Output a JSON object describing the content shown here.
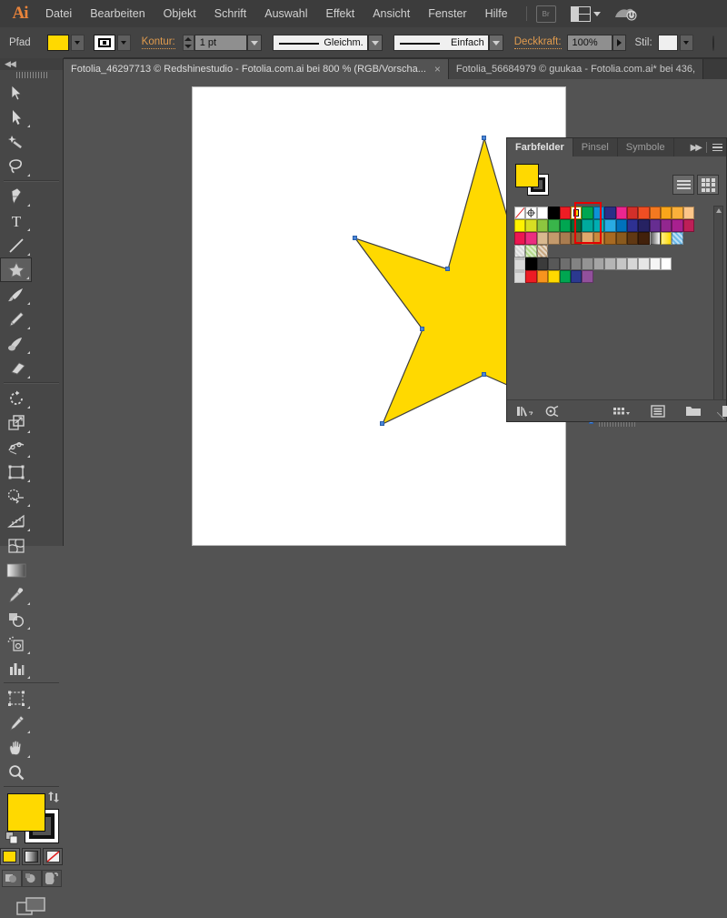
{
  "app": {
    "logo": "Ai",
    "menu": [
      "Datei",
      "Bearbeiten",
      "Objekt",
      "Schrift",
      "Auswahl",
      "Effekt",
      "Ansicht",
      "Fenster",
      "Hilfe"
    ],
    "bridge_label": "Br",
    "arrange_label": "arrange-documents",
    "cloud_label": "creative-cloud-sync"
  },
  "control_bar": {
    "object_type": "Pfad",
    "fill_color": "#ffd900",
    "stroke_color": "#000000",
    "stroke_label": "Kontur:",
    "stroke_weight": "1 pt",
    "variable_width_profile": "Gleichm.",
    "brush_definition": "Einfach",
    "opacity_label": "Deckkraft:",
    "opacity_value": "100%",
    "style_label": "Stil:",
    "style_swatch": "#efefef"
  },
  "tabs": [
    {
      "title": "Fotolia_46297713 © Redshinestudio - Fotolia.com.ai bei 800 % (RGB/Vorscha...",
      "close": "×",
      "active": true
    },
    {
      "title": "Fotolia_56684979 © guukaa - Fotolia.com.ai* bei 436,",
      "close": "",
      "active": false
    }
  ],
  "tools": {
    "header_collapse": "◀◀",
    "items": [
      {
        "name": "selection-tool",
        "selected": false
      },
      {
        "name": "direct-selection-tool",
        "selected": false
      },
      {
        "name": "magic-wand-tool",
        "selected": false
      },
      {
        "name": "lasso-tool",
        "selected": false
      },
      {
        "name": "pen-tool",
        "selected": false
      },
      {
        "name": "type-tool",
        "selected": false
      },
      {
        "name": "line-segment-tool",
        "selected": false
      },
      {
        "name": "star-tool",
        "selected": true
      },
      {
        "name": "paintbrush-tool",
        "selected": false
      },
      {
        "name": "pencil-tool",
        "selected": false
      },
      {
        "name": "blob-brush-tool",
        "selected": false
      },
      {
        "name": "eraser-tool",
        "selected": false
      },
      {
        "name": "rotate-tool",
        "selected": false
      },
      {
        "name": "scale-tool",
        "selected": false
      },
      {
        "name": "width-tool",
        "selected": false
      },
      {
        "name": "free-transform-tool",
        "selected": false
      },
      {
        "name": "shape-builder-tool",
        "selected": false
      },
      {
        "name": "perspective-grid-tool",
        "selected": false
      },
      {
        "name": "mesh-tool",
        "selected": false
      },
      {
        "name": "gradient-tool",
        "selected": false
      },
      {
        "name": "eyedropper-tool",
        "selected": false
      },
      {
        "name": "blend-tool",
        "selected": false
      },
      {
        "name": "symbol-sprayer-tool",
        "selected": false
      },
      {
        "name": "column-graph-tool",
        "selected": false
      },
      {
        "name": "artboard-tool",
        "selected": false
      },
      {
        "name": "slice-tool",
        "selected": false
      },
      {
        "name": "hand-tool",
        "selected": false
      },
      {
        "name": "zoom-tool",
        "selected": false
      }
    ],
    "fill_color": "#ffd900",
    "stroke_color": "#000000",
    "fill_modes": [
      "color-fill",
      "gradient-fill",
      "none-fill"
    ],
    "draw_modes": [
      "draw-normal",
      "draw-behind",
      "draw-inside"
    ],
    "screen_mode": "change-screen-mode"
  },
  "swatches_panel": {
    "tabs": [
      {
        "label": "Farbfelder",
        "active": true
      },
      {
        "label": "Pinsel",
        "active": false
      },
      {
        "label": "Symbole",
        "active": false
      }
    ],
    "collapse_icon": "▶▶",
    "menu_icon": "panel-menu",
    "current_fill": "#ffd900",
    "current_stroke": "#000000",
    "view_modes": [
      "list-view",
      "grid-view"
    ],
    "selected_swatch": "#ffd900",
    "highlight_box_color": "#e60000",
    "rows": [
      {
        "cells": [
          {
            "type": "none",
            "color": "#ffffff"
          },
          {
            "type": "registration",
            "color": "#ffffff"
          },
          {
            "type": "color",
            "color": "#ffffff"
          },
          {
            "type": "color",
            "color": "#000000"
          },
          {
            "type": "color",
            "color": "#ed1c24"
          },
          {
            "type": "color",
            "color": "#ffd900",
            "selected": true
          },
          {
            "type": "color",
            "color": "#00a651"
          },
          {
            "type": "color",
            "color": "#0c93d8"
          },
          {
            "type": "color",
            "color": "#2b2f87"
          },
          {
            "type": "color",
            "color": "#ec268f"
          },
          {
            "type": "color",
            "color": "#d32f2a"
          },
          {
            "type": "color",
            "color": "#f04e23"
          },
          {
            "type": "color",
            "color": "#f47920"
          },
          {
            "type": "color",
            "color": "#faa61a"
          },
          {
            "type": "color",
            "color": "#fbb03b"
          },
          {
            "type": "color",
            "color": "#fdc689"
          }
        ]
      },
      {
        "cells": [
          {
            "type": "color",
            "color": "#fff200"
          },
          {
            "type": "color",
            "color": "#d7df23"
          },
          {
            "type": "color",
            "color": "#8dc63f"
          },
          {
            "type": "color",
            "color": "#39b54a"
          },
          {
            "type": "color",
            "color": "#00a651"
          },
          {
            "type": "color",
            "color": "#006838"
          },
          {
            "type": "color",
            "color": "#00a99d"
          },
          {
            "type": "color",
            "color": "#00aeb3"
          },
          {
            "type": "color",
            "color": "#29abe2"
          },
          {
            "type": "color",
            "color": "#0072bc"
          },
          {
            "type": "color",
            "color": "#2e3192"
          },
          {
            "type": "color",
            "color": "#262262"
          },
          {
            "type": "color",
            "color": "#662d91"
          },
          {
            "type": "color",
            "color": "#92278f"
          },
          {
            "type": "color",
            "color": "#a8208f"
          },
          {
            "type": "color",
            "color": "#bd1f57"
          }
        ]
      },
      {
        "cells": [
          {
            "type": "color",
            "color": "#ed1651"
          },
          {
            "type": "color",
            "color": "#ec2d7f"
          },
          {
            "type": "color",
            "color": "#d9b98f"
          },
          {
            "type": "color",
            "color": "#c49a6c"
          },
          {
            "type": "color",
            "color": "#a97c50"
          },
          {
            "type": "color",
            "color": "#8c6239"
          },
          {
            "type": "color",
            "color": "#e0a96d"
          },
          {
            "type": "color",
            "color": "#c98a3e"
          },
          {
            "type": "color",
            "color": "#a86a22"
          },
          {
            "type": "color",
            "color": "#8a5a1e"
          },
          {
            "type": "color",
            "color": "#603813"
          },
          {
            "type": "color",
            "color": "#42210b"
          },
          {
            "type": "gradient",
            "color": "#ffffff"
          },
          {
            "type": "gradient",
            "color": "#ffd900"
          },
          {
            "type": "pattern",
            "color": "#6db9e8"
          }
        ]
      },
      {
        "cells": [
          {
            "type": "pattern",
            "color": "#d8d8d8"
          },
          {
            "type": "pattern",
            "color": "#b4d98c"
          },
          {
            "type": "pattern",
            "color": "#c8a882"
          }
        ]
      },
      {
        "folder": true,
        "cells": [
          {
            "type": "color",
            "color": "#000000"
          },
          {
            "type": "color",
            "color": "#3b3b3b"
          },
          {
            "type": "color",
            "color": "#585858"
          },
          {
            "type": "color",
            "color": "#6e6e6e"
          },
          {
            "type": "color",
            "color": "#838383"
          },
          {
            "type": "color",
            "color": "#949494"
          },
          {
            "type": "color",
            "color": "#a5a5a5"
          },
          {
            "type": "color",
            "color": "#b5b5b5"
          },
          {
            "type": "color",
            "color": "#c6c6c6"
          },
          {
            "type": "color",
            "color": "#d6d6d6"
          },
          {
            "type": "color",
            "color": "#e6e6e6"
          },
          {
            "type": "color",
            "color": "#f5f5f5"
          },
          {
            "type": "color",
            "color": "#ffffff"
          }
        ]
      },
      {
        "folder": true,
        "cells": [
          {
            "type": "color",
            "color": "#ed1c24"
          },
          {
            "type": "color",
            "color": "#f7941e"
          },
          {
            "type": "color",
            "color": "#ffd900"
          },
          {
            "type": "color",
            "color": "#00a651"
          },
          {
            "type": "color",
            "color": "#2b3990"
          },
          {
            "type": "color",
            "color": "#92509c"
          }
        ]
      }
    ],
    "footer_buttons": [
      "swatch-libraries-menu",
      "show-swatch-kinds-menu",
      "swatch-options",
      "new-color-group",
      "new-swatch",
      "delete-swatch"
    ]
  },
  "canvas": {
    "artboard_background": "#ffffff",
    "shape": {
      "name": "star",
      "fill": "#ffd900",
      "stroke": "#3a3a3a",
      "points": 5,
      "anchor_color": "#4a86d8",
      "anchor_count": 10
    },
    "cursor": "crosshair-eyedropper"
  }
}
